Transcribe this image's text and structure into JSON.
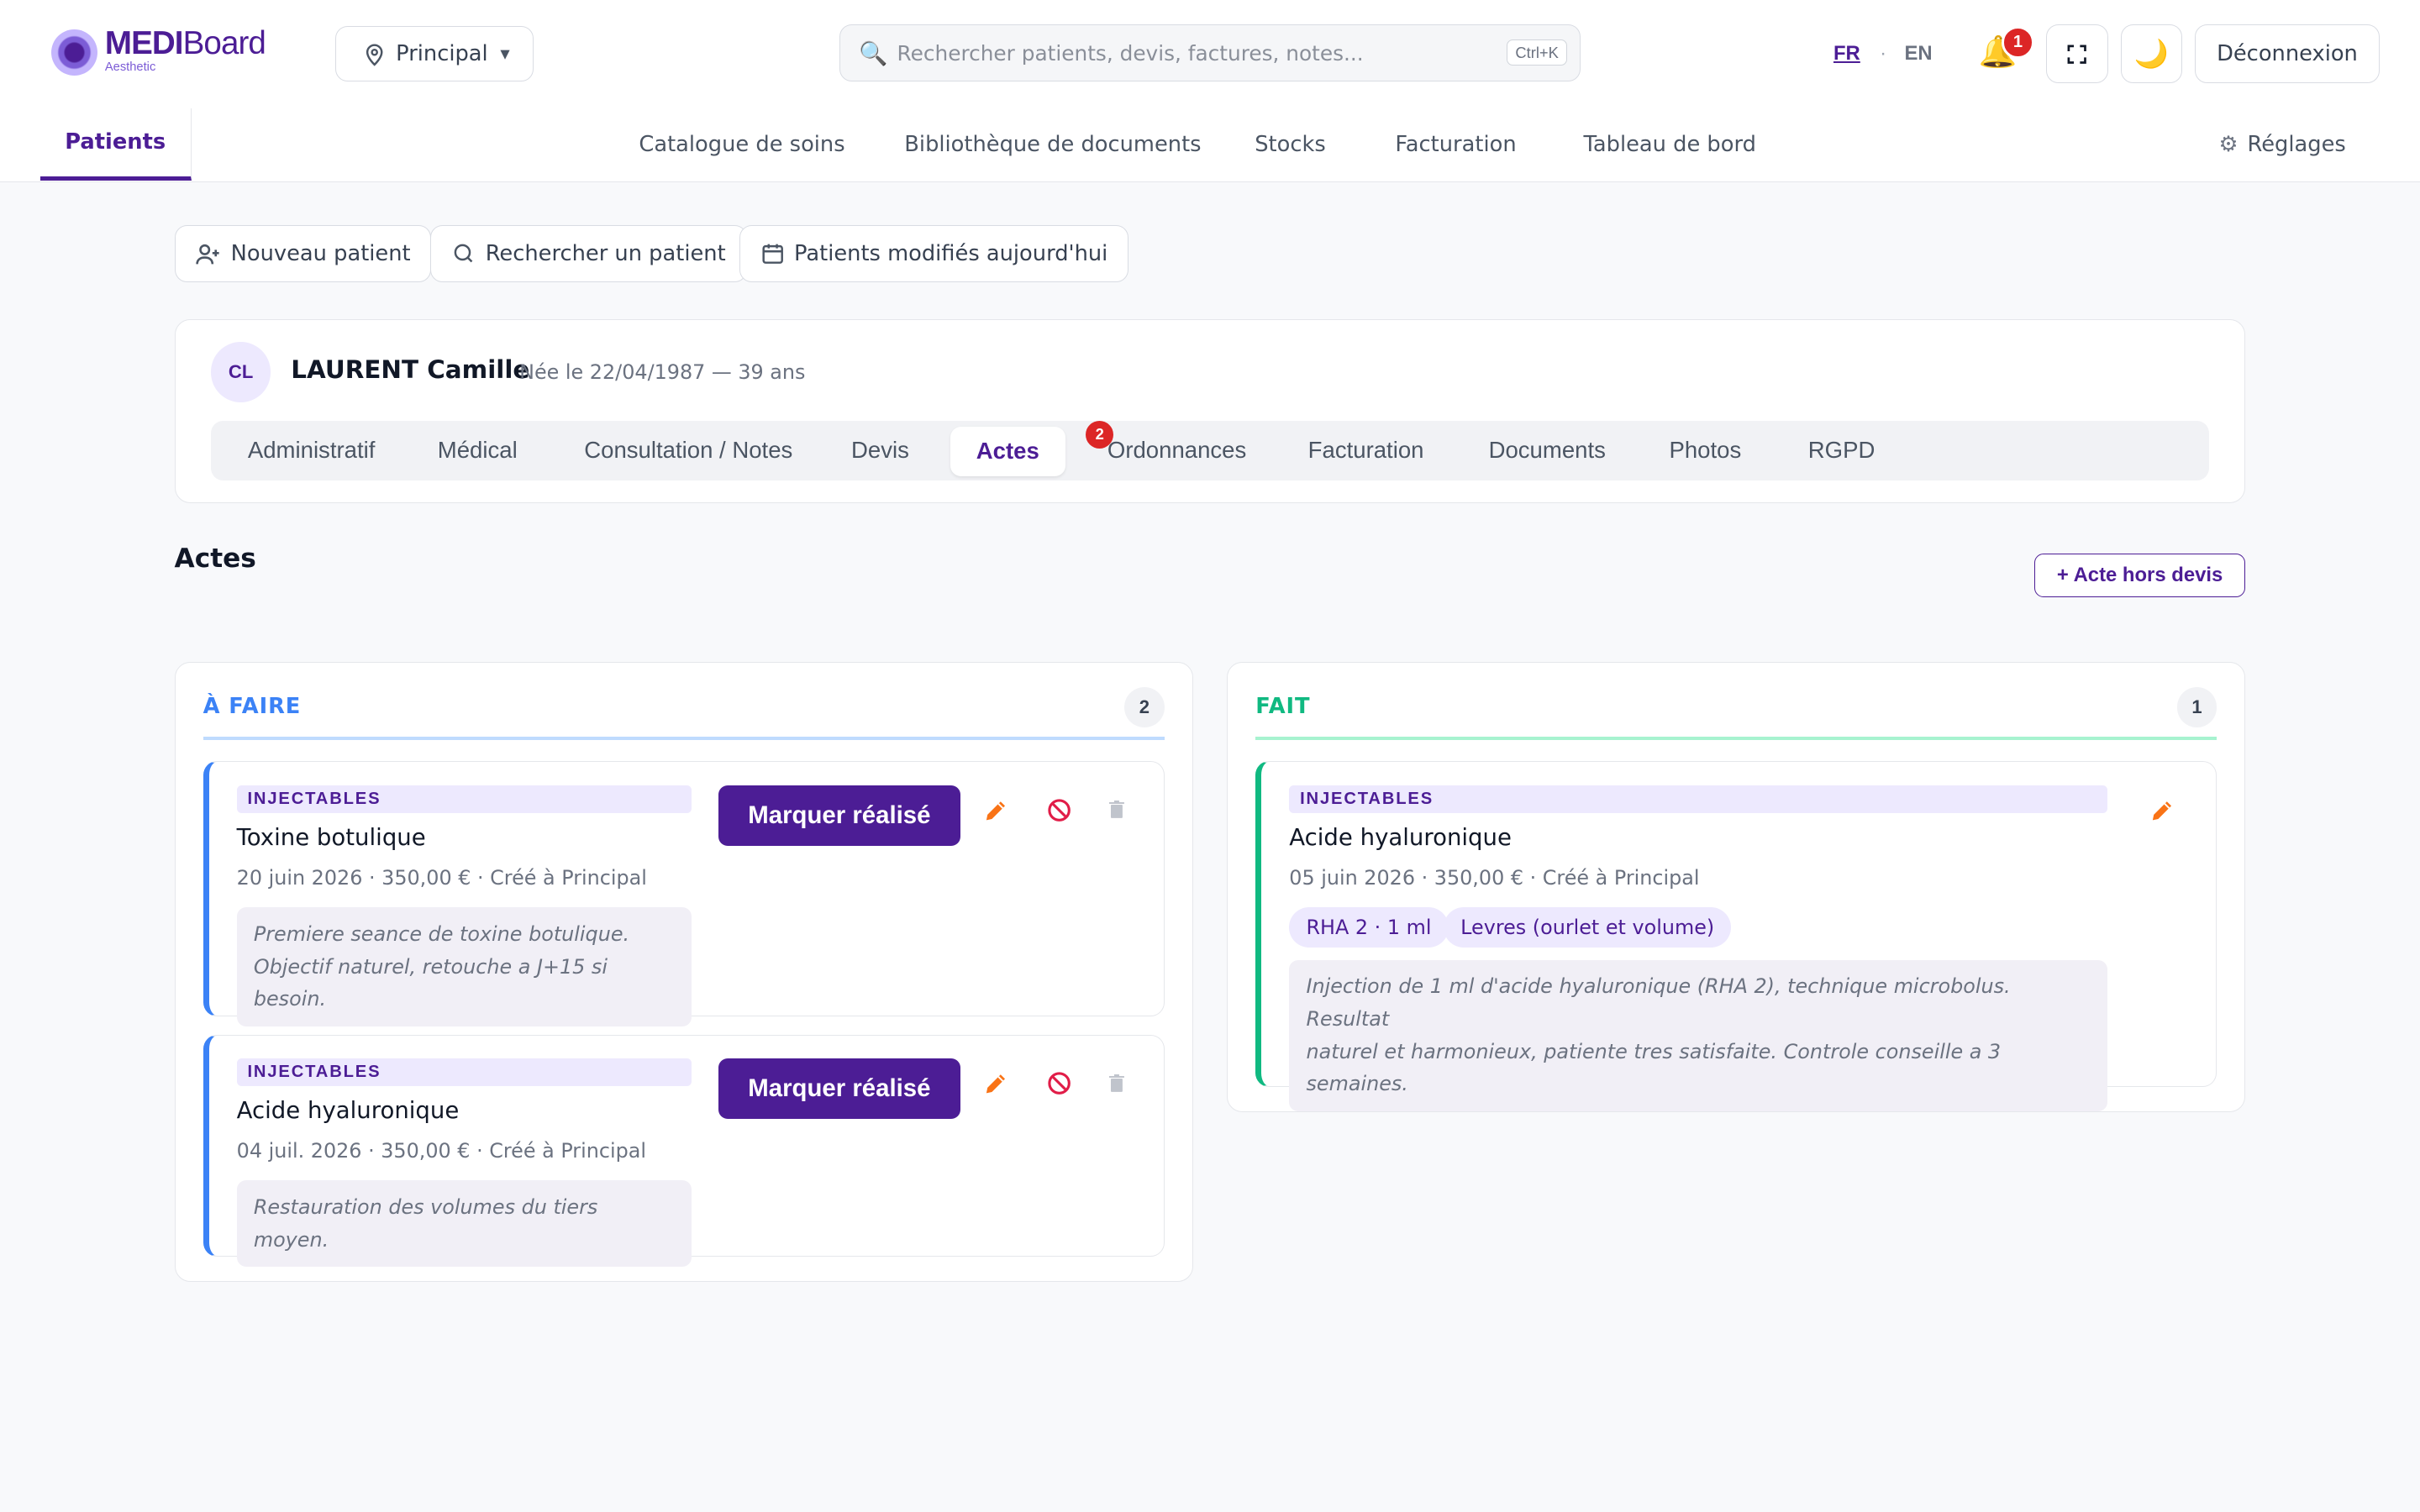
{
  "app": {
    "brand_bold": "MEDI",
    "brand_rest": "Board",
    "brand_sub": "Aesthetic"
  },
  "header": {
    "site": "Principal",
    "search_placeholder": "Rechercher patients, devis, factures, notes...",
    "search_shortcut": "Ctrl+K",
    "lang_fr": "FR",
    "lang_sep": "·",
    "lang_en": "EN",
    "notification_count": "1",
    "logout": "Déconnexion"
  },
  "nav": {
    "active": "Patients",
    "items": [
      "Catalogue de soins",
      "Bibliothèque de documents",
      "Stocks",
      "Facturation",
      "Tableau de bord"
    ],
    "settings": "Réglages"
  },
  "actions": {
    "new_patient": "Nouveau patient",
    "search_patient": "Rechercher un patient",
    "modified_today": "Patients modifiés aujourd'hui"
  },
  "patient": {
    "initials": "CL",
    "name": "LAURENT Camille",
    "birth": "Née le 22/04/1987 — 39 ans",
    "tabs": [
      "Administratif",
      "Médical",
      "Consultation / Notes",
      "Devis",
      "Actes",
      "Ordonnances",
      "Facturation",
      "Documents",
      "Photos",
      "RGPD"
    ],
    "active_tab": "Actes",
    "actes_badge": "2"
  },
  "section": {
    "title": "Actes",
    "add_button": "+ Acte hors devis"
  },
  "todo": {
    "title": "À FAIRE",
    "count": "2",
    "mark_label": "Marquer réalisé",
    "cards": [
      {
        "category": "INJECTABLES",
        "title": "Toxine botulique",
        "meta": "20 juin 2026 · 350,00 € · Créé à Principal",
        "note_lines": [
          "Premiere seance de toxine botulique.",
          "Objectif naturel, retouche a J+15 si besoin."
        ]
      },
      {
        "category": "INJECTABLES",
        "title": "Acide hyaluronique",
        "meta": "04 juil. 2026 · 350,00 € · Créé à Principal",
        "note_lines": [
          "Restauration des volumes du tiers moyen."
        ]
      }
    ]
  },
  "done": {
    "title": "FAIT",
    "count": "1",
    "cards": [
      {
        "category": "INJECTABLES",
        "title": "Acide hyaluronique",
        "meta": "05 juin 2026 · 350,00 € · Créé à Principal",
        "chips": [
          "RHA 2 · 1 ml",
          "Levres (ourlet et volume)"
        ],
        "note_lines": [
          "Injection de 1 ml d'acide hyaluronique (RHA 2), technique microbolus. Resultat",
          "naturel et harmonieux, patiente tres satisfaite. Controle conseille a 3 semaines."
        ]
      }
    ]
  },
  "colors": {
    "brand": "#4c1d95",
    "todo_accent": "#3b82f6",
    "done_accent": "#10b981",
    "edit_icon": "#f97316",
    "cancel_icon": "#e11d48",
    "badge": "#dc2626"
  }
}
